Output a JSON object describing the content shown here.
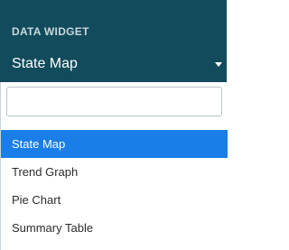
{
  "widget": {
    "section_label": "DATA WIDGET",
    "selected_value": "State Map",
    "caret_icon": "caret-down-icon"
  },
  "dropdown": {
    "search": {
      "value": "",
      "placeholder": ""
    },
    "options": [
      {
        "label": "State Map",
        "selected": true
      },
      {
        "label": "Trend Graph",
        "selected": false
      },
      {
        "label": "Pie Chart",
        "selected": false
      },
      {
        "label": "Summary Table",
        "selected": false
      }
    ]
  },
  "colors": {
    "header_bg": "#124b5c",
    "section_label": "#c9d8dd",
    "selected_bg": "#1a7ee8",
    "text": "#2b2b2b"
  }
}
